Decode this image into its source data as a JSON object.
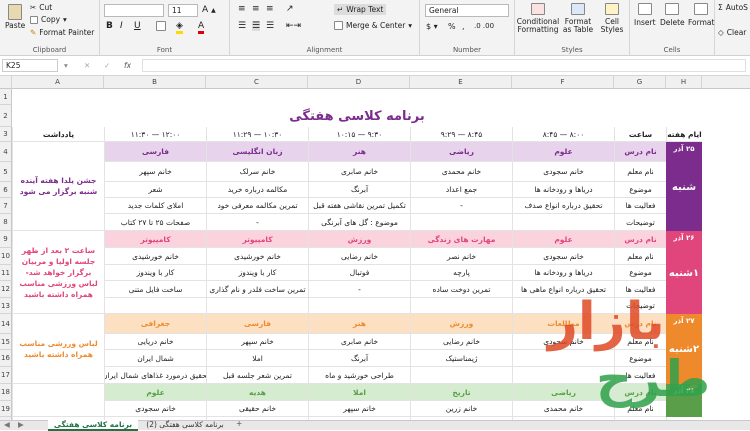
{
  "ribbon": {
    "paste": "Paste",
    "cut": "Cut",
    "copy": "Copy",
    "format_painter": "Format Painter",
    "clipboard": "Clipboard",
    "font_size": "11",
    "font": "Font",
    "wrap_text": "Wrap Text",
    "merge_center": "Merge & Center",
    "alignment": "Alignment",
    "number_format": "General",
    "number": "Number",
    "conditional_formatting": "Conditional Formatting",
    "format_as_table": "Format as Table",
    "cell_styles": "Cell Styles",
    "styles": "Styles",
    "insert": "Insert",
    "delete": "Delete",
    "format": "Format",
    "cells": "Cells",
    "autosum": "AutoS",
    "clear": "Clear"
  },
  "formula_bar": {
    "name_box": "K25",
    "fx": "fx"
  },
  "columns": [
    "A",
    "B",
    "C",
    "D",
    "E",
    "F",
    "G",
    "H"
  ],
  "rows": [
    "1",
    "2",
    "3",
    "4",
    "5",
    "6",
    "7",
    "8",
    "9",
    "10",
    "11",
    "12",
    "13",
    "14",
    "15",
    "16",
    "17",
    "18",
    "19",
    "20"
  ],
  "sheet": {
    "title": "برنامه کلاسی هفتگی",
    "headers": {
      "week_days": "ایام هفته",
      "hour": "ساعت",
      "notes": "یادداشت",
      "t1": "۸:۰۰ — ۸:۴۵",
      "t2": "۸:۴۵ — ۹:۲۹",
      "t3": "۹:۳۰ — ۱۰:۱۵",
      "t4": "۱۰:۳۰ — ۱۱:۲۹",
      "t5": "۱۲:۰۰ — ۱۱:۳۰"
    },
    "labels": {
      "subject": "نام درس",
      "teacher": "نام معلم",
      "topic": "موضوع",
      "activity": "فعالیت ها",
      "desc": "توضیحات"
    },
    "days": [
      {
        "date": "۲۵ آذر",
        "name": "شنبه",
        "rows": [
          [
            "علوم",
            "ریاضی",
            "هنر",
            "زبان انگلیسی",
            "فارسی"
          ],
          [
            "خانم سجودی",
            "خانم محمدی",
            "خانم صابری",
            "خانم سرلک",
            "خانم سپهر"
          ],
          [
            "دریاها و رودخانه ها",
            "جمع اعداد",
            "آبرنگ",
            "مکالمه درباره خرید",
            "شعر"
          ],
          [
            "تحقیق درباره انواع صدف",
            "-",
            "تکمیل تمرین نقاشی هفته قبل",
            "تمرین مکالمه معرفی خود",
            "املای کلمات جدید"
          ],
          [
            "",
            "",
            "موضوع : گل های آبرنگی",
            "-",
            "صفحات ۲۵ تا ۲۷ کتاب"
          ]
        ],
        "note": "جشن یلدا هفته آینده شنبه برگزار می شود"
      },
      {
        "date": "۲۶ آذر",
        "name": "۱شنبه",
        "rows": [
          [
            "علوم",
            "مهارت های زندگی",
            "ورزش",
            "کامپیوتر",
            "کامپیوتر"
          ],
          [
            "خانم سجودی",
            "خانم نصر",
            "خانم رضایی",
            "خانم خورشیدی",
            "خانم خورشیدی"
          ],
          [
            "دریاها و رودخانه ها",
            "پارچه",
            "فوتبال",
            "کار با ویندوز",
            "کار با ویندوز"
          ],
          [
            "تحقیق درباره انواع ماهی ها",
            "تمرین دوخت ساده",
            "-",
            "تمرین ساخت فلدر و نام گذاری",
            "ساخت فایل متنی"
          ],
          [
            "",
            "",
            "",
            "",
            ""
          ]
        ],
        "note": "ساعت ۲ بعد از ظهر جلسه اولیا و مربیان برگزار خواهد شد-لباس ورزشی مناسب همراه داشته باشید"
      },
      {
        "date": "۲۷ آذر",
        "name": "۲شنبه",
        "rows": [
          [
            "مطالعات",
            "ورزش",
            "هنر",
            "فارسی",
            "جغرافی"
          ],
          [
            "خانم سجودی",
            "خانم رضایی",
            "خانم صابری",
            "خانم سپهر",
            "خانم دریایی"
          ],
          [
            "",
            "ژیمناستیک",
            "آبرنگ",
            "املا",
            "شمال ایران"
          ],
          [
            "",
            "",
            "طراحی خورشید و ماه",
            "تمرین شعر جلسه قبل",
            "تحقیق درمورد غذاهای شمال ایران"
          ]
        ],
        "note": "لباس ورزشی مناسب همراه داشته باشید"
      },
      {
        "date": "۲۸ آذر",
        "name": "",
        "rows": [
          [
            "ریاضی",
            "تاریخ",
            "املا",
            "هدیه",
            "علوم"
          ],
          [
            "خانم محمدی",
            "خانم زرین",
            "خانم سپهر",
            "خانم حقیقی",
            "خانم سجودی"
          ]
        ],
        "note": ""
      }
    ]
  },
  "tabs": {
    "active": "برنامه کلاسی هفتگی",
    "other": "برنامه کلاسی هفتگی (2)",
    "add": "+"
  },
  "watermark": {
    "line1": "بازار",
    "line2": "طرح"
  },
  "colors": {
    "purple": "#7b2c8c",
    "pink": "#e0457b",
    "orange": "#ee8a2c",
    "green": "#5a9e4a",
    "watermark": "#e04a26"
  }
}
